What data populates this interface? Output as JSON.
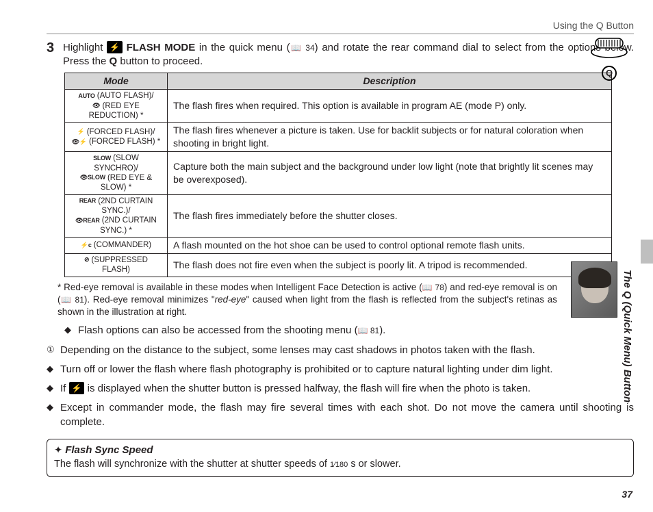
{
  "header": {
    "section": "Using the Q Button"
  },
  "step": {
    "number": "3",
    "pre": "Highlight ",
    "flashIcon": "⚡",
    "mode": "FLASH MODE",
    "mid1": " in the quick menu (",
    "ref1": "📖 34",
    "mid2": ") and rotate the rear command dial to select from the options below.  Press the ",
    "qbtn": "Q",
    "tail": " button to proceed."
  },
  "table": {
    "h1": "Mode",
    "h2": "Description",
    "rows": [
      {
        "m1": "AUTO",
        "m1b": "(AUTO FLASH)/",
        "m2": "👁",
        "m2b": "(RED EYE REDUCTION) *",
        "desc": "The flash fires when required.  This option is available in program AE (mode P) only."
      },
      {
        "m1": "⚡",
        "m1b": "(FORCED FLASH)/",
        "m2": "👁⚡",
        "m2b": "(FORCED FLASH) *",
        "desc": "The flash fires whenever a picture is taken.  Use for backlit subjects or for natural coloration when shooting in bright light."
      },
      {
        "m1": "SLOW",
        "m1b": "(SLOW SYNCHRO)/",
        "m2": "👁SLOW",
        "m2b": "(RED EYE & SLOW) *",
        "desc": "Capture both the main subject and the background under low light (note that brightly lit scenes may be overexposed)."
      },
      {
        "m1": "REAR",
        "m1b": "(2ND CURTAIN SYNC.)/",
        "m2": "👁REAR",
        "m2b": "(2ND CURTAIN SYNC.) *",
        "desc": "The flash fires immediately before the shutter closes."
      },
      {
        "m1": "⚡c",
        "m1b": "(COMMANDER)",
        "desc": "A flash mounted on the hot shoe can be used to control optional remote flash units."
      },
      {
        "m1": "⊘",
        "m1b": "(SUPPRESSED FLASH)",
        "desc": "The flash does not fire even when the subject is poorly lit.  A tripod is recommended."
      }
    ]
  },
  "footnote": {
    "pre": "* Red-eye removal is available in these modes when Intelligent Face Detection is active (",
    "ref1": "📖 78",
    "mid1": ") and red-eye removal is on (",
    "ref2": "📖 81",
    "mid2": ").  Red-eye removal minimizes \"",
    "em": "red-eye",
    "tail": "\" caused when light from the flash is reflected from the subject's retinas as shown in the illustration at right."
  },
  "bullets": {
    "b1a": "Flash options can also be accessed from the shooting menu (",
    "b1ref": "📖 81",
    "b1b": ").",
    "b2": "Depending on the distance to the subject, some lenses may cast shadows in photos taken with the flash.",
    "b3": "Turn off or lower the flash where flash photography is prohibited or to capture natural lighting under dim light.",
    "b4a": "If ",
    "b4icon": "⚡",
    "b4b": " is displayed when the shutter button is pressed halfway, the flash will fire when the photo is taken.",
    "b5": "Except in commander mode, the flash may fire several times with each shot.  Do not move the camera until shooting is complete."
  },
  "note": {
    "marker": "✦",
    "title": "Flash Sync Speed",
    "body_pre": "The flash will synchronize with the shutter at shutter speeds of ",
    "frac": "1⁄180",
    "body_post": " s or slower."
  },
  "side": {
    "label": "The Q (Quick Menu) Button"
  },
  "page": {
    "num": "37"
  },
  "dial": {
    "q": "Q"
  }
}
